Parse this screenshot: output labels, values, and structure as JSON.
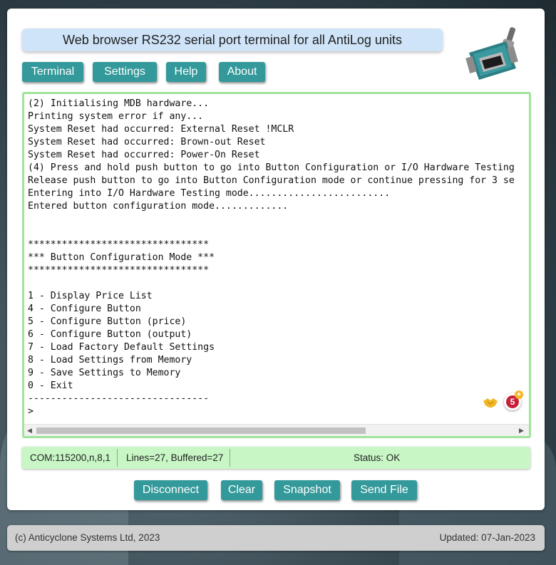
{
  "header": {
    "title": "Web browser RS232 serial port terminal for all AntiLog units",
    "logo_icon": "serial-connector-icon"
  },
  "nav": {
    "items": [
      "Terminal",
      "Settings",
      "Help",
      "About"
    ]
  },
  "terminal": {
    "lines": [
      "(2) Initialising MDB hardware...",
      "Printing system error if any...",
      "System Reset had occurred: External Reset !MCLR",
      "System Reset had occurred: Brown-out Reset",
      "System Reset had occurred: Power-On Reset",
      "(4) Press and hold push button to go into Button Configuration or I/O Hardware Testing",
      "Release push button to go into Button Configuration mode or continue pressing for 3 se",
      "Entering into I/O Hardware Testing mode.........................",
      "Entered button configuration mode.............",
      "",
      "",
      "********************************",
      "*** Button Configuration Mode ***",
      "********************************",
      "",
      "1 - Display Price List",
      "4 - Configure Button",
      "5 - Configure Button (price)",
      "6 - Configure Button (output)",
      "7 - Load Factory Default Settings",
      "8 - Load Settings from Memory",
      "9 - Save Settings to Memory",
      "0 - Exit",
      "--------------------------------",
      ">"
    ],
    "badge_count": "5",
    "extension_icon": "handshake-icon"
  },
  "status": {
    "port": "COM:115200,n,8,1",
    "lines": "Lines=27, Buffered=27",
    "state": "Status: OK"
  },
  "actions": {
    "disconnect": "Disconnect",
    "clear": "Clear",
    "snapshot": "Snapshot",
    "send_file": "Send File"
  },
  "footer": {
    "copyright": "(c) Anticyclone Systems Ltd, 2023",
    "updated": "Updated: 07-Jan-2023"
  },
  "colors": {
    "accent": "#33999a",
    "terminal_border": "#9fe49a",
    "status_bg": "#c8f7c5",
    "title_bg": "#cfe4f8"
  }
}
